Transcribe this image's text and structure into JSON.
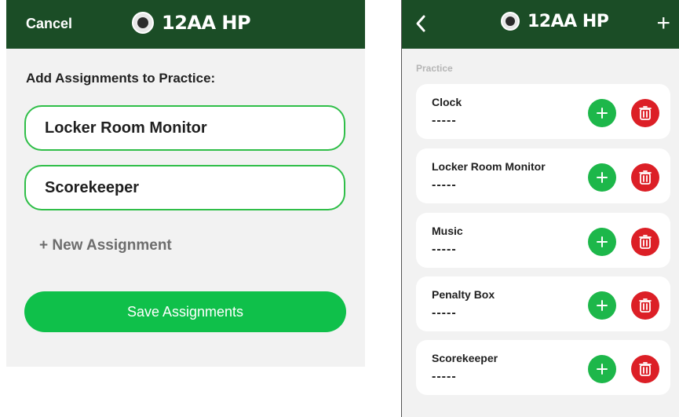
{
  "left_screen": {
    "nav": {
      "cancel_label": "Cancel",
      "title": "12AA HP",
      "logo_icon": "team-logo-icon"
    },
    "heading": "Add Assignments to Practice:",
    "assignment_fields": [
      "Locker Room Monitor",
      "Scorekeeper"
    ],
    "new_assignment_label": "+ New Assignment",
    "save_label": "Save Assignments"
  },
  "right_screen": {
    "nav": {
      "back_icon": "chevron-left-icon",
      "title": "12AA HP",
      "logo_icon": "team-logo-icon",
      "add_icon": "plus-icon"
    },
    "section_label": "Practice",
    "assignments": [
      {
        "title": "Clock",
        "assignee": "-----"
      },
      {
        "title": "Locker Room Monitor",
        "assignee": "-----"
      },
      {
        "title": "Music",
        "assignee": "-----"
      },
      {
        "title": "Penalty Box",
        "assignee": "-----"
      },
      {
        "title": "Scorekeeper",
        "assignee": "-----"
      }
    ]
  },
  "colors": {
    "nav_bg": "#1b4d26",
    "accent_green": "#0fc04a",
    "delete_red": "#dc1f26",
    "field_border": "#2fbe48"
  }
}
